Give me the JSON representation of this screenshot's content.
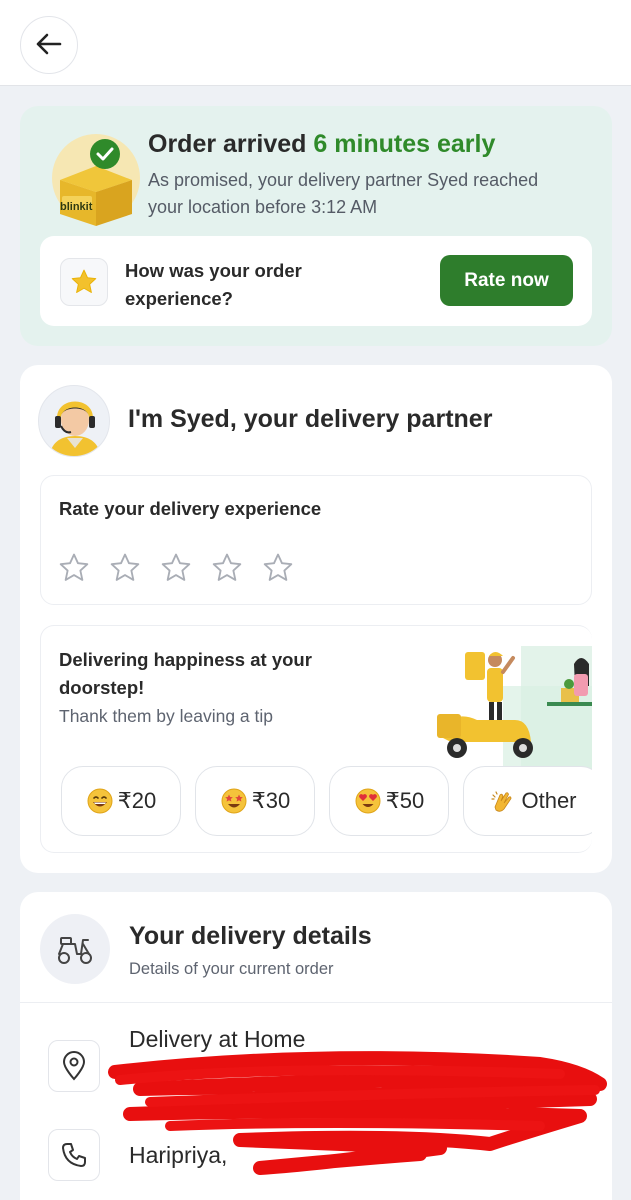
{
  "header": {
    "back_icon": "arrow-left-icon"
  },
  "arrival": {
    "title_prefix": "Order arrived ",
    "title_highlight": "6 minutes early",
    "subtitle": "As promised, your delivery partner Syed reached your location before 3:12 AM",
    "brand_label": "blinkit",
    "rating_prompt": "How was your order experience?",
    "rate_button": "Rate now",
    "accent_color": "#2f8a2a"
  },
  "partner": {
    "title": "I'm Syed, your delivery partner",
    "rate_label": "Rate your delivery experience",
    "stars": 5,
    "tip_title": "Delivering happiness at your doorstep!",
    "tip_subtitle": "Thank them by leaving a tip",
    "tips": [
      {
        "label": "₹20",
        "icon": "grin-emoji-icon"
      },
      {
        "label": "₹30",
        "icon": "star-struck-emoji-icon"
      },
      {
        "label": "₹50",
        "icon": "heart-eyes-emoji-icon"
      },
      {
        "label": "Other",
        "icon": "clapping-hands-icon"
      }
    ]
  },
  "details": {
    "title": "Your delivery details",
    "subtitle": "Details of your current order",
    "location_label": "Delivery at Home",
    "contact_name": "Haripriya, "
  }
}
